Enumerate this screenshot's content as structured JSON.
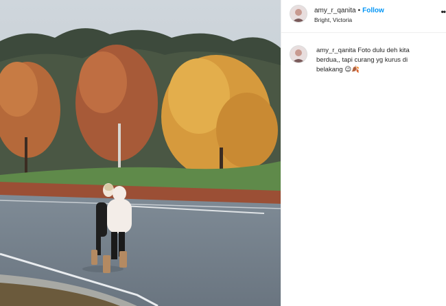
{
  "post": {
    "username": "amy_r_qanita",
    "separator": "•",
    "follow_label": "Follow",
    "location": "Bright, Victoria",
    "more_icon": "more-options-icon",
    "more_glyph": "••"
  },
  "caption": {
    "username": "amy_r_qanita",
    "text": "Foto dulu deh kita berdua,, tapi curang yg kurus di belakang 😉🍂"
  },
  "colors": {
    "link": "#0095f6",
    "text": "#262626",
    "divider": "#efefef"
  }
}
